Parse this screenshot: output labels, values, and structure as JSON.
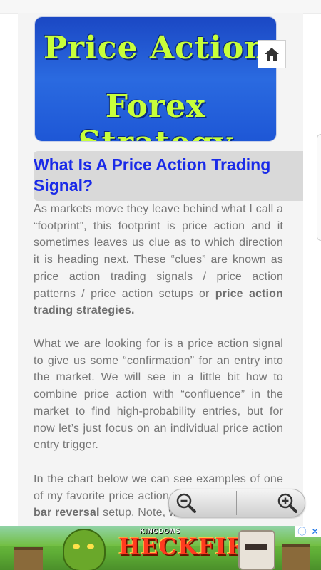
{
  "banner": {
    "line1": "Price Action",
    "line2": "Forex Strategy"
  },
  "home_icon": "home-icon",
  "article": {
    "heading": "What Is A Price Action Trading Signal?",
    "p1_text": "As markets move they leave behind what I call a “footprint”, this footprint is price action and it sometimes leaves us clue as to which direction it is heading next. These “clues” are known as price action trading signals / price action patterns / price action setups or ",
    "p1_bold": "price action trading strategies.",
    "p2_text": "What we are looking for is a price action signal to give us some “confirmation” for an entry into the market. We will see in a little bit how to combine price action with “confluence” in the market to find high-probability entries, but for now let’s just focus on an individual price action entry trigger.",
    "p3_text_a": "In the chart below we can see examples of one of my favorite price action setups called the ",
    "p3_bold": "pin bar reversal",
    "p3_text_b": " setup. Note, we included a"
  },
  "zoom": {
    "out_icon": "zoom-out-icon",
    "in_icon": "zoom-in-icon"
  },
  "ad": {
    "kingdoms": "KINGDOMS",
    "title": "HECKFIRE",
    "info_icon": "ⓘ",
    "close_icon": "✕"
  },
  "colors": {
    "heading_text": "#1a2be8",
    "heading_bg": "#d9d9d9",
    "body_text": "#757575",
    "banner_blue": "#1e57d6",
    "banner_text": "#c8ff3a"
  }
}
